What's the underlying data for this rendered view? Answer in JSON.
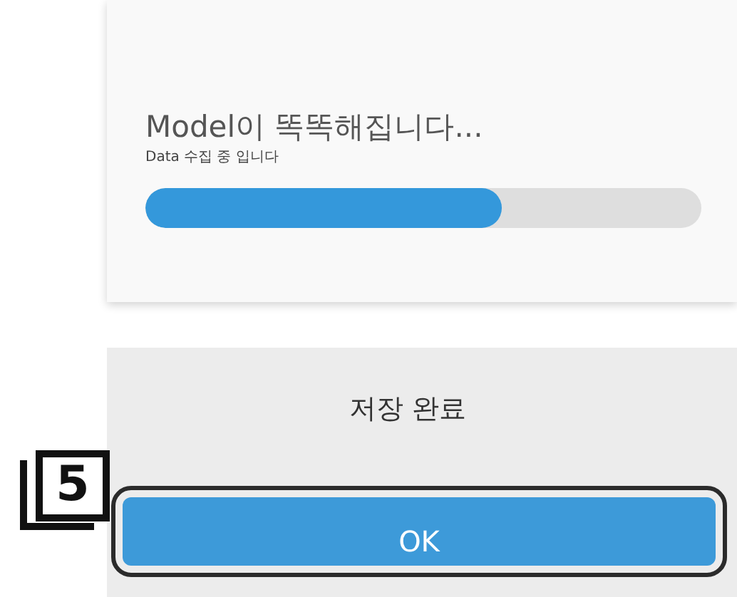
{
  "progress_card": {
    "title": "Model이 똑똑해집니다...",
    "subtitle": "Data 수집 중 입니다",
    "level": 0.64
  },
  "save_card": {
    "message": "저장 완료",
    "button": "OK",
    "highlighted": true
  },
  "step_marker": "5"
}
